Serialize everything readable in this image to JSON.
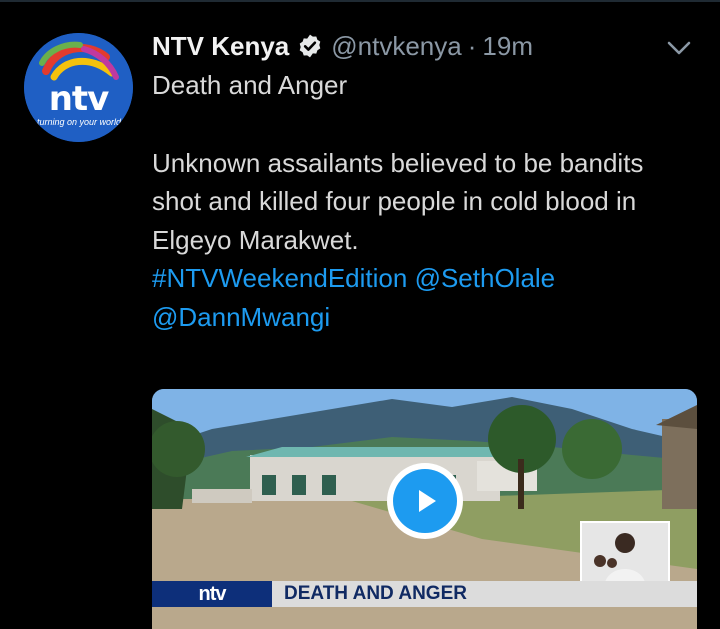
{
  "tweet": {
    "display_name": "NTV Kenya",
    "handle": "@ntvkenya",
    "separator": "·",
    "time": "19m",
    "title_line": "Death and Anger",
    "body": "Unknown assailants believed to be bandits shot and killed four people in cold blood in Elgeyo Marakwet.",
    "hashtag": "#NTVWeekendEdition",
    "mention1": "@SethOlale",
    "mention2": "@DannMwangi"
  },
  "avatar": {
    "logo_text": "ntv",
    "slogan": "turning on your world"
  },
  "video": {
    "brand_tag": "ntv",
    "headline": "DEATH AND ANGER"
  },
  "colors": {
    "background": "#000000",
    "link": "#1d9bf0",
    "muted": "#8b98a5"
  },
  "icons": {
    "verified": "verified-badge-icon",
    "more": "chevron-down-icon",
    "play": "play-icon"
  }
}
